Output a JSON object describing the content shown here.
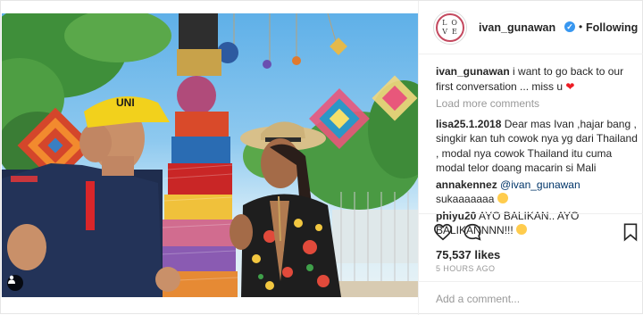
{
  "post": {
    "photo_alt": "",
    "hat_text": "UNI"
  },
  "header": {
    "avatar_text": [
      "L",
      "O",
      "V",
      "E"
    ],
    "handle": "ivan_gunawan",
    "dot": "•",
    "follow_label": "Following"
  },
  "comments": {
    "caption_user": "ivan_gunawan",
    "caption_text": " i want to go back to our first conversation ... miss u ",
    "caption_heart": "❤",
    "load_more": "Load more comments",
    "items": [
      {
        "user": "lisa25.1.2018",
        "text": " Dear mas Ivan ,hajar bang , singkir kan tuh cowok nya yg dari Thailand , modal nya cowok Thailand itu cuma modal telor doang macarin si Mali"
      },
      {
        "user": "annakennez",
        "mention": "@ivan_gunawan",
        "text": " sukaaaaaaa"
      },
      {
        "user": "phiyu20",
        "text": " AYO BALIKAN.. AYO BALIKANNNN!!! "
      }
    ]
  },
  "actions": {
    "likes": "75,537 likes",
    "time_ago": "5 HOURS AGO",
    "add_comment_placeholder": "Add a comment..."
  },
  "icons": {
    "heart": "heart-icon",
    "comment": "comment-icon",
    "bookmark": "bookmark-icon",
    "verified": "verified-badge-icon",
    "user_tag": "user-tag-icon"
  },
  "colors": {
    "verified_blue": "#3897f0",
    "mention": "#003569",
    "muted": "#999999",
    "caption_heart": "#ed1c24"
  }
}
